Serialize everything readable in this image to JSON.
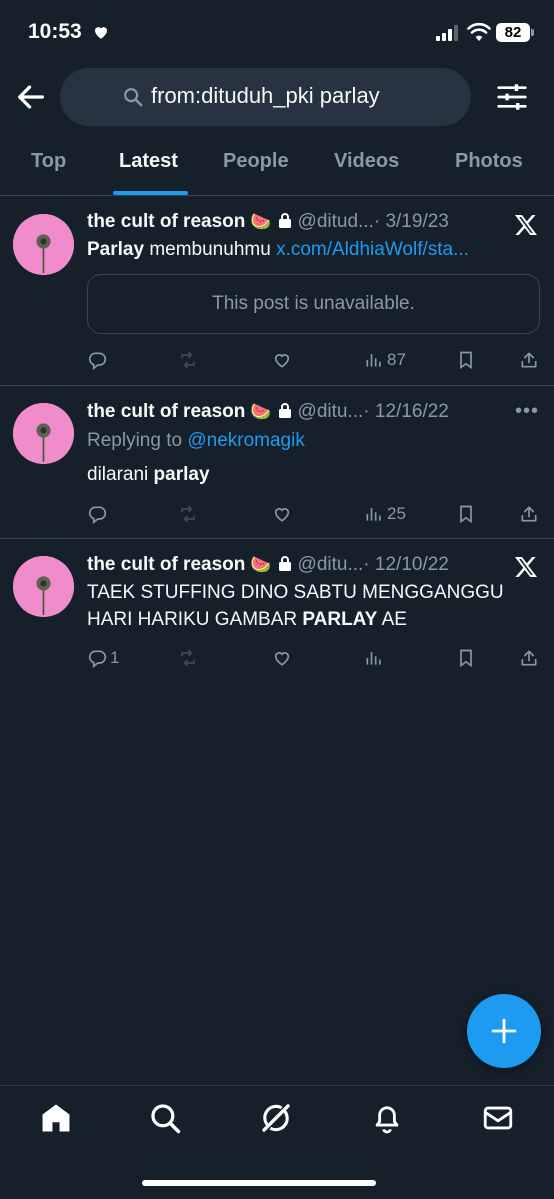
{
  "status_bar": {
    "time": "10:53",
    "battery": "82"
  },
  "search": {
    "query": "from:dituduh_pki parlay"
  },
  "tabs": [
    "Top",
    "Latest",
    "People",
    "Videos",
    "Photos"
  ],
  "tweets": [
    {
      "name": "the cult of reason",
      "emoji": "🍉",
      "handle": "@ditud...",
      "date": "· 3/19/23",
      "text_bold": "Parlay",
      "text": " membunuhmu ",
      "link": "x.com/AldhiaWolf/sta...",
      "quote": "This post is unavailable.",
      "views": "87"
    },
    {
      "name": "the cult of reason",
      "emoji": "🍉",
      "handle": "@ditu...",
      "date": "· 12/16/22",
      "replying_prefix": "Replying to ",
      "replying_to": "@nekromagik",
      "text": "dilarani ",
      "text_bold": "parlay",
      "views": "25"
    },
    {
      "name": "the cult of reason",
      "emoji": "🍉",
      "handle": "@ditu...",
      "date": "· 12/10/22",
      "line1": "TAEK STUFFING DINO SABTU MENGGANGGU",
      "line2_pre": "HARI HARIKU GAMBAR ",
      "line2_bold": "PARLAY",
      "line2_post": " AE",
      "replies": "1"
    }
  ],
  "colors": {
    "background": "#15202b",
    "accent": "#1d9bf0",
    "muted": "#8b98a5",
    "avatar": "#f08ccb"
  },
  "icons": [
    "heart-icon",
    "signal-icon",
    "wifi-icon",
    "back-arrow-icon",
    "search-icon",
    "filter-icon",
    "x-logo-icon",
    "more-icon",
    "reply-icon",
    "retweet-icon",
    "like-icon",
    "views-icon",
    "bookmark-icon",
    "share-icon",
    "compose-icon",
    "home-icon",
    "explore-icon",
    "grok-icon",
    "notifications-icon",
    "messages-icon"
  ]
}
